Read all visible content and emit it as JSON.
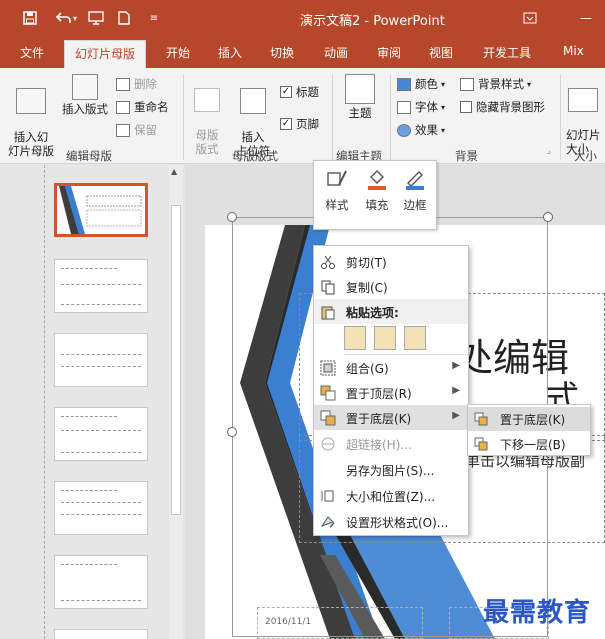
{
  "window": {
    "title": "演示文稿2 - PowerPoint",
    "qat": {
      "save_icon": "save-icon",
      "undo_icon": "undo-icon",
      "present_icon": "present-icon",
      "new_icon": "new-file-icon",
      "more_icon": "customize-qat-icon"
    },
    "controls": {
      "restore": "❐",
      "minimize": "—"
    }
  },
  "tabs": [
    {
      "label": "文件"
    },
    {
      "label": "幻灯片母版",
      "active": true
    },
    {
      "label": "开始"
    },
    {
      "label": "插入"
    },
    {
      "label": "切换"
    },
    {
      "label": "动画"
    },
    {
      "label": "审阅"
    },
    {
      "label": "视图"
    },
    {
      "label": "开发工具"
    },
    {
      "label": "Mix"
    }
  ],
  "ribbon": {
    "edit_master": {
      "label": "编辑母版",
      "insert_master": "插入幻\n灯片母版",
      "insert_layout": "插入版式",
      "delete": "删除",
      "rename": "重命名",
      "preserve": "保留"
    },
    "master_layout": {
      "label": "母版版式",
      "master_layout_btn": "母版\n版式",
      "insert_placeholder": "插入\n占位符",
      "title_check": "标题",
      "footer_check": "页脚"
    },
    "edit_theme": {
      "label": "编辑主题",
      "theme": "主题"
    },
    "background": {
      "label": "背景",
      "colors": "颜色",
      "fonts": "字体",
      "effects": "效果",
      "bg_styles": "背景样式",
      "hide_bg": "隐藏背景图形"
    },
    "size": {
      "label": "大小",
      "slide_size": "幻灯片\n大小"
    }
  },
  "mini_toolbar": {
    "style": "样式",
    "fill": "填充",
    "outline": "边框"
  },
  "context_menu": {
    "cut": "剪切(T)",
    "copy": "复制(C)",
    "paste_options": "粘贴选项:",
    "group": "组合(G)",
    "bring_front": "置于顶层(R)",
    "send_back": "置于底层(K)",
    "hyperlink": "超链接(H)...",
    "save_as_picture": "另存为图片(S)...",
    "size_position": "大小和位置(Z)...",
    "format_shape": "设置形状格式(O)..."
  },
  "submenu": {
    "send_to_back": "置于底层(K)",
    "send_backward": "下移一层(B)"
  },
  "slide": {
    "title_fragment_1": "处编辑",
    "title_fragment_2": "式",
    "subtitle_fragment": "单击以编辑母版副",
    "date": "2016/11/1",
    "colors": {
      "blue": "#3b7fd0",
      "dark": "#3d3d3d",
      "gray": "#8c8c8c"
    }
  },
  "watermark": "最需教育",
  "colors": {
    "accent": "#b7472a",
    "ribbon": "#f3f3f3",
    "selected_thumb": "#d35230"
  }
}
